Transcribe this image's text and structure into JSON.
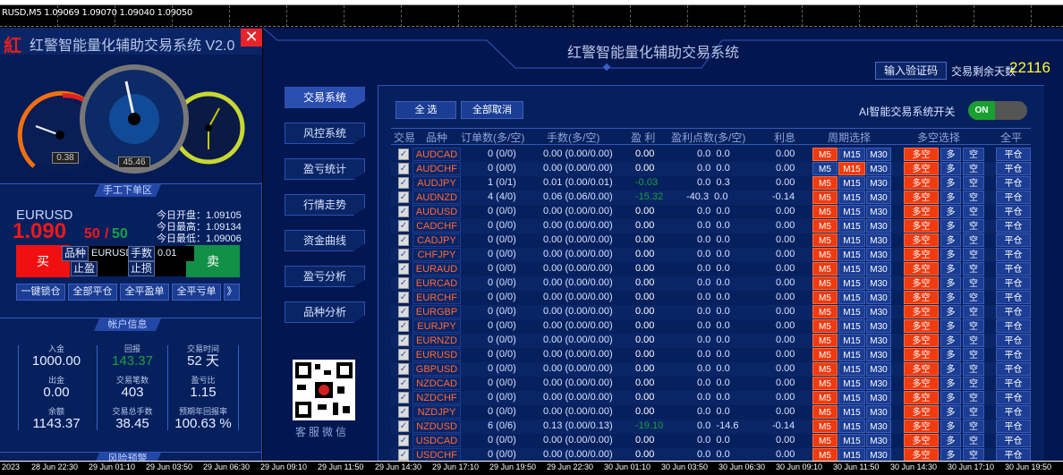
{
  "chart_header": {
    "ticker": "RUSD,M5  1.09069 1.09070 1.09040 1.09050"
  },
  "left": {
    "title": "红警智能量化辅助交易系统  V2.0",
    "close": "✕",
    "logo": "红",
    "gauges": {
      "left_value": "0.38",
      "center_value": "45.46"
    },
    "manual_section": "手工下单区",
    "symbol": "EURUSD",
    "price_main": "1.090",
    "price_pts1": "50",
    "price_slash": "/",
    "price_pts2": "50",
    "today_open": "今日开盘：1.09105",
    "today_high": "今日最高：1.09134",
    "today_low": "今日最低：1.09006",
    "buy": "买",
    "sell": "卖",
    "order": {
      "symbol_label": "品种",
      "symbol_value": "EURUSD",
      "lots_label": "手数",
      "lots_value": "0.01",
      "tp_label": "止盈",
      "sl_label": "止损"
    },
    "actions": [
      "一键锁仓",
      "全部平仓",
      "全平盈单",
      "全平亏单",
      "》"
    ],
    "account_section": "帐户信息",
    "account": [
      {
        "label": "入金",
        "value": "1000.00"
      },
      {
        "label": "回报",
        "value": "143.37"
      },
      {
        "label": "交易时间",
        "value": "52 天"
      },
      {
        "label": "出金",
        "value": "0.00"
      },
      {
        "label": "交易笔数",
        "value": "403"
      },
      {
        "label": "盈亏比",
        "value": "1.15"
      },
      {
        "label": "余额",
        "value": "1143.37"
      },
      {
        "label": "交易总手数",
        "value": "38.45"
      },
      {
        "label": "预期年回报率",
        "value": "100.63 %"
      }
    ],
    "risk_section": "风险预警"
  },
  "right": {
    "title": "红警智能量化辅助交易系统",
    "verify_button": "输入验证码",
    "days_label": "交易剩余天数",
    "days_value": "22116",
    "menu": [
      "交易系统",
      "风控系统",
      "盈亏统计",
      "行情走势",
      "资金曲线",
      "盈亏分析",
      "品种分析"
    ],
    "qr_caption": "客服微信",
    "select_all": "全 选",
    "deselect_all": "全部取消",
    "ai_label": "AI智能交易系统开关",
    "toggle": "ON",
    "headers": [
      "交易",
      "品种",
      "订单数(多/空)",
      "手数(多/空)",
      "盈 利",
      "盈利点数(多/空)",
      "利息",
      "周期选择",
      "多空选择",
      "全平"
    ],
    "period_labels": [
      "M5",
      "M15",
      "M30"
    ],
    "dir_labels": [
      "多空",
      "多",
      "空"
    ],
    "close_label": "平仓",
    "rows": [
      [
        "AUDCAD",
        "0 (0/0)",
        "0.00 (0.00/0.00)",
        "0.00",
        "0.0  0.0",
        "0.00",
        "M5"
      ],
      [
        "AUDCHF",
        "0 (0/0)",
        "0.00 (0.00/0.00)",
        "0.00",
        "0.0  0.0",
        "0.00",
        "M15"
      ],
      [
        "AUDJPY",
        "1 (0/1)",
        "0.01 (0.00/0.01)",
        "-0.03",
        "0.0  0.3",
        "0.00",
        "M5"
      ],
      [
        "AUDNZD",
        "4 (4/0)",
        "0.06 (0.06/0.00)",
        "-15.32",
        "-40.3  0.0",
        "-0.14",
        "M5"
      ],
      [
        "AUDUSD",
        "0 (0/0)",
        "0.00 (0.00/0.00)",
        "0.00",
        "0.0  0.0",
        "0.00",
        "M5"
      ],
      [
        "CADCHF",
        "0 (0/0)",
        "0.00 (0.00/0.00)",
        "0.00",
        "0.0  0.0",
        "0.00",
        "M5"
      ],
      [
        "CADJPY",
        "0 (0/0)",
        "0.00 (0.00/0.00)",
        "0.00",
        "0.0  0.0",
        "0.00",
        "M5"
      ],
      [
        "CHFJPY",
        "0 (0/0)",
        "0.00 (0.00/0.00)",
        "0.00",
        "0.0  0.0",
        "0.00",
        "M5"
      ],
      [
        "EURAUD",
        "0 (0/0)",
        "0.00 (0.00/0.00)",
        "0.00",
        "0.0  0.0",
        "0.00",
        "M5"
      ],
      [
        "EURCAD",
        "0 (0/0)",
        "0.00 (0.00/0.00)",
        "0.00",
        "0.0  0.0",
        "0.00",
        "M5"
      ],
      [
        "EURCHF",
        "0 (0/0)",
        "0.00 (0.00/0.00)",
        "0.00",
        "0.0  0.0",
        "0.00",
        "M5"
      ],
      [
        "EURGBP",
        "0 (0/0)",
        "0.00 (0.00/0.00)",
        "0.00",
        "0.0  0.0",
        "0.00",
        "M5"
      ],
      [
        "EURJPY",
        "0 (0/0)",
        "0.00 (0.00/0.00)",
        "0.00",
        "0.0  0.0",
        "0.00",
        "M5"
      ],
      [
        "EURNZD",
        "0 (0/0)",
        "0.00 (0.00/0.00)",
        "0.00",
        "0.0  0.0",
        "0.00",
        "M5"
      ],
      [
        "EURUSD",
        "0 (0/0)",
        "0.00 (0.00/0.00)",
        "0.00",
        "0.0  0.0",
        "0.00",
        "M5"
      ],
      [
        "GBPUSD",
        "0 (0/0)",
        "0.00 (0.00/0.00)",
        "0.00",
        "0.0  0.0",
        "0.00",
        "M5"
      ],
      [
        "NZDCAD",
        "0 (0/0)",
        "0.00 (0.00/0.00)",
        "0.00",
        "0.0  0.0",
        "0.00",
        "M5"
      ],
      [
        "NZDCHF",
        "0 (0/0)",
        "0.00 (0.00/0.00)",
        "0.00",
        "0.0  0.0",
        "0.00",
        "M5"
      ],
      [
        "NZDJPY",
        "0 (0/0)",
        "0.00 (0.00/0.00)",
        "0.00",
        "0.0  0.0",
        "0.00",
        "M5"
      ],
      [
        "NZDUSD",
        "6 (0/6)",
        "0.13 (0.00/0.13)",
        "-19.10",
        "0.0  -14.6",
        "-0.14",
        "M5"
      ],
      [
        "USDCAD",
        "0 (0/0)",
        "0.00 (0.00/0.00)",
        "0.00",
        "0.0  0.0",
        "0.00",
        "M5"
      ],
      [
        "USDCHF",
        "0 (0/0)",
        "0.00 (0.00/0.00)",
        "0.00",
        "0.0  0.0",
        "0.00",
        "M5"
      ]
    ]
  },
  "time_axis": [
    "2023",
    "28 Jun 22:30",
    "29 Jun 01:10",
    "29 Jun 03:50",
    "29 Jun 06:30",
    "29 Jun 09:10",
    "29 Jun 11:50",
    "29 Jun 14:30",
    "29 Jun 17:10",
    "29 Jun 19:50",
    "29 Jun 22:30",
    "30 Jun 01:10",
    "30 Jun 03:50",
    "30 Jun 06:30",
    "30 Jun 09:10",
    "30 Jun 11:50",
    "30 Jun 14:30",
    "30 Jun 17:10",
    "30 Jun 19:50"
  ],
  "colors": {
    "red": "#f01010",
    "green": "#129048",
    "accent": "#2a4db0",
    "bg": "#06205e",
    "highlight": "#f03a10"
  }
}
